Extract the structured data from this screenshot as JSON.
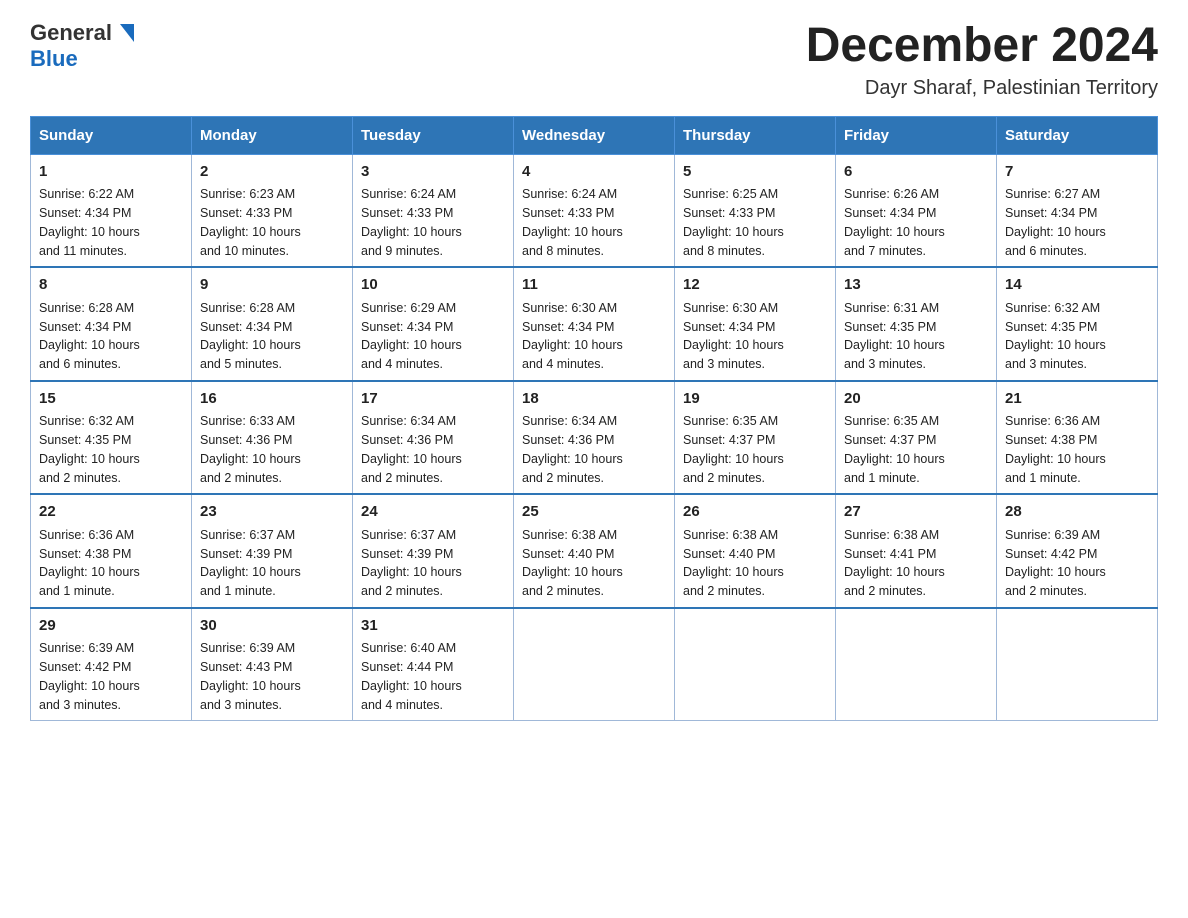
{
  "header": {
    "logo_general": "General",
    "logo_blue": "Blue",
    "title": "December 2024",
    "subtitle": "Dayr Sharaf, Palestinian Territory"
  },
  "days_of_week": [
    "Sunday",
    "Monday",
    "Tuesday",
    "Wednesday",
    "Thursday",
    "Friday",
    "Saturday"
  ],
  "weeks": [
    [
      {
        "day": "1",
        "sunrise": "6:22 AM",
        "sunset": "4:34 PM",
        "daylight": "10 hours and 11 minutes."
      },
      {
        "day": "2",
        "sunrise": "6:23 AM",
        "sunset": "4:33 PM",
        "daylight": "10 hours and 10 minutes."
      },
      {
        "day": "3",
        "sunrise": "6:24 AM",
        "sunset": "4:33 PM",
        "daylight": "10 hours and 9 minutes."
      },
      {
        "day": "4",
        "sunrise": "6:24 AM",
        "sunset": "4:33 PM",
        "daylight": "10 hours and 8 minutes."
      },
      {
        "day": "5",
        "sunrise": "6:25 AM",
        "sunset": "4:33 PM",
        "daylight": "10 hours and 8 minutes."
      },
      {
        "day": "6",
        "sunrise": "6:26 AM",
        "sunset": "4:34 PM",
        "daylight": "10 hours and 7 minutes."
      },
      {
        "day": "7",
        "sunrise": "6:27 AM",
        "sunset": "4:34 PM",
        "daylight": "10 hours and 6 minutes."
      }
    ],
    [
      {
        "day": "8",
        "sunrise": "6:28 AM",
        "sunset": "4:34 PM",
        "daylight": "10 hours and 6 minutes."
      },
      {
        "day": "9",
        "sunrise": "6:28 AM",
        "sunset": "4:34 PM",
        "daylight": "10 hours and 5 minutes."
      },
      {
        "day": "10",
        "sunrise": "6:29 AM",
        "sunset": "4:34 PM",
        "daylight": "10 hours and 4 minutes."
      },
      {
        "day": "11",
        "sunrise": "6:30 AM",
        "sunset": "4:34 PM",
        "daylight": "10 hours and 4 minutes."
      },
      {
        "day": "12",
        "sunrise": "6:30 AM",
        "sunset": "4:34 PM",
        "daylight": "10 hours and 3 minutes."
      },
      {
        "day": "13",
        "sunrise": "6:31 AM",
        "sunset": "4:35 PM",
        "daylight": "10 hours and 3 minutes."
      },
      {
        "day": "14",
        "sunrise": "6:32 AM",
        "sunset": "4:35 PM",
        "daylight": "10 hours and 3 minutes."
      }
    ],
    [
      {
        "day": "15",
        "sunrise": "6:32 AM",
        "sunset": "4:35 PM",
        "daylight": "10 hours and 2 minutes."
      },
      {
        "day": "16",
        "sunrise": "6:33 AM",
        "sunset": "4:36 PM",
        "daylight": "10 hours and 2 minutes."
      },
      {
        "day": "17",
        "sunrise": "6:34 AM",
        "sunset": "4:36 PM",
        "daylight": "10 hours and 2 minutes."
      },
      {
        "day": "18",
        "sunrise": "6:34 AM",
        "sunset": "4:36 PM",
        "daylight": "10 hours and 2 minutes."
      },
      {
        "day": "19",
        "sunrise": "6:35 AM",
        "sunset": "4:37 PM",
        "daylight": "10 hours and 2 minutes."
      },
      {
        "day": "20",
        "sunrise": "6:35 AM",
        "sunset": "4:37 PM",
        "daylight": "10 hours and 1 minute."
      },
      {
        "day": "21",
        "sunrise": "6:36 AM",
        "sunset": "4:38 PM",
        "daylight": "10 hours and 1 minute."
      }
    ],
    [
      {
        "day": "22",
        "sunrise": "6:36 AM",
        "sunset": "4:38 PM",
        "daylight": "10 hours and 1 minute."
      },
      {
        "day": "23",
        "sunrise": "6:37 AM",
        "sunset": "4:39 PM",
        "daylight": "10 hours and 1 minute."
      },
      {
        "day": "24",
        "sunrise": "6:37 AM",
        "sunset": "4:39 PM",
        "daylight": "10 hours and 2 minutes."
      },
      {
        "day": "25",
        "sunrise": "6:38 AM",
        "sunset": "4:40 PM",
        "daylight": "10 hours and 2 minutes."
      },
      {
        "day": "26",
        "sunrise": "6:38 AM",
        "sunset": "4:40 PM",
        "daylight": "10 hours and 2 minutes."
      },
      {
        "day": "27",
        "sunrise": "6:38 AM",
        "sunset": "4:41 PM",
        "daylight": "10 hours and 2 minutes."
      },
      {
        "day": "28",
        "sunrise": "6:39 AM",
        "sunset": "4:42 PM",
        "daylight": "10 hours and 2 minutes."
      }
    ],
    [
      {
        "day": "29",
        "sunrise": "6:39 AM",
        "sunset": "4:42 PM",
        "daylight": "10 hours and 3 minutes."
      },
      {
        "day": "30",
        "sunrise": "6:39 AM",
        "sunset": "4:43 PM",
        "daylight": "10 hours and 3 minutes."
      },
      {
        "day": "31",
        "sunrise": "6:40 AM",
        "sunset": "4:44 PM",
        "daylight": "10 hours and 4 minutes."
      },
      null,
      null,
      null,
      null
    ]
  ],
  "labels": {
    "sunrise": "Sunrise:",
    "sunset": "Sunset:",
    "daylight": "Daylight:"
  }
}
